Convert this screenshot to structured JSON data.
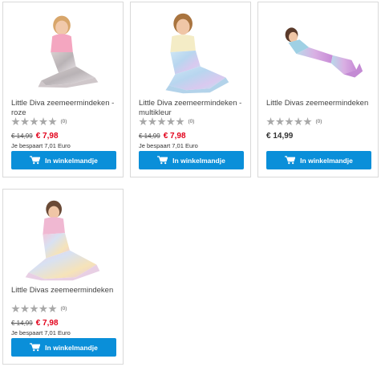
{
  "products": [
    {
      "title": "Little Diva zeemeermindeken - roze",
      "rating_count": "(0)",
      "old_price": "€ 14,99",
      "price": "€ 7,98",
      "savings": "Je bespaart 7,01 Euro",
      "button_label": "In winkelmandje"
    },
    {
      "title": "Little Diva zeemeermindeken - multikleur",
      "rating_count": "(0)",
      "old_price": "€ 14,99",
      "price": "€ 7,98",
      "savings": "Je bespaart 7,01 Euro",
      "button_label": "In winkelmandje"
    },
    {
      "title": "Little Divas zeemeermindeken",
      "rating_count": "(0)",
      "price": "€ 14,99",
      "button_label": "In winkelmandje"
    },
    {
      "title": "Little Divas zeemeermindeken",
      "rating_count": "(0)",
      "old_price": "€ 14,99",
      "price": "€ 7,98",
      "savings": "Je bespaart 7,01 Euro",
      "button_label": "In winkelmandje"
    }
  ],
  "colors": {
    "button_blue": "#0a8fd9",
    "sale_red": "#e2001a",
    "star_grey": "#a8a8a8",
    "card_border": "#d9d9d9"
  },
  "icons": {
    "cart": "shopping-cart-icon",
    "star": "star-icon"
  }
}
